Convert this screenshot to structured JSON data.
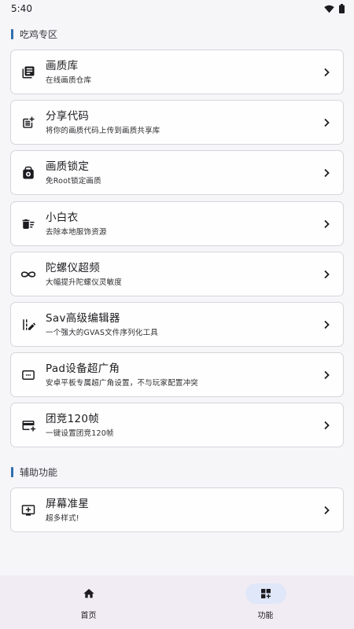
{
  "status_bar": {
    "time": "5:40",
    "wifi_icon": "wifi-icon",
    "battery_icon": "battery-icon"
  },
  "sections": [
    {
      "title": "吃鸡专区",
      "items": [
        {
          "title": "画质库",
          "subtitle": "在线画质仓库",
          "icon": "library-books-icon"
        },
        {
          "title": "分享代码",
          "subtitle": "将你的画质代码上传到画质共享库",
          "icon": "post-add-icon"
        },
        {
          "title": "画质锁定",
          "subtitle": "免Root锁定画质",
          "icon": "lock-screen-icon"
        },
        {
          "title": "小白衣",
          "subtitle": "去除本地服饰资源",
          "icon": "delete-sweep-icon"
        },
        {
          "title": "陀螺仪超频",
          "subtitle": "大幅提升陀螺仪灵敏度",
          "icon": "infinity-icon"
        },
        {
          "title": "Sav高级编辑器",
          "subtitle": "一个强大的GVAS文件序列化工具",
          "icon": "edit-note-icon"
        },
        {
          "title": "Pad设备超广角",
          "subtitle": "安卓平板专属超广角设置，不与玩家配置冲突",
          "icon": "aspect-ratio-icon"
        },
        {
          "title": "团竞120帧",
          "subtitle": "一键设置团竞120帧",
          "icon": "add-card-icon"
        }
      ]
    },
    {
      "title": "辅助功能",
      "items": [
        {
          "title": "屏幕准星",
          "subtitle": "超多样式!",
          "icon": "add-to-queue-icon"
        }
      ]
    }
  ],
  "bottom_nav": [
    {
      "label": "首页",
      "icon": "home-icon",
      "active": false
    },
    {
      "label": "功能",
      "icon": "widgets-add-icon",
      "active": true
    }
  ]
}
